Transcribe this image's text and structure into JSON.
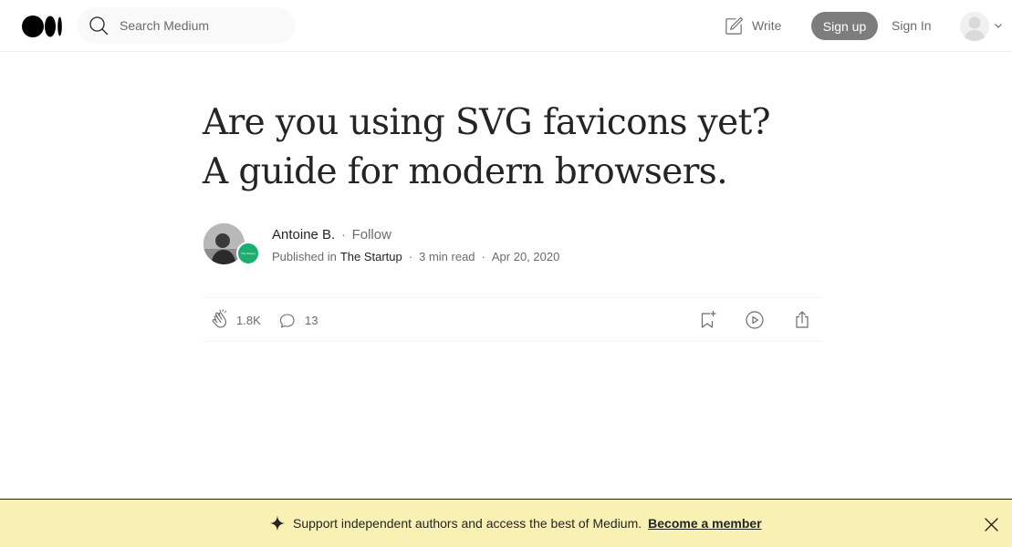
{
  "header": {
    "logo_icon": "medium-logo-icon",
    "search": {
      "placeholder": "Search Medium",
      "value": ""
    },
    "write_label": "Write",
    "signup_label": "Sign up",
    "signin_label": "Sign In"
  },
  "article": {
    "title": "Are you using SVG favicons yet? A guide for modern browsers.",
    "author": "Antoine B.",
    "separator": "·",
    "follow_label": "Follow",
    "published_in_label": "Published in",
    "publication": "The Startup",
    "read_time": "3 min read",
    "date": "Apr 20, 2020"
  },
  "actions": {
    "claps": "1.8K",
    "responses": "13"
  },
  "banner": {
    "text": "Support independent authors and access the best of Medium.",
    "link_label": "Become a member",
    "background": "#f9f0b3"
  },
  "colors": {
    "text": "#242424",
    "muted": "#6b6b6b",
    "signup_button": "#7d7d7d",
    "publication_badge": "#1aae6f"
  }
}
